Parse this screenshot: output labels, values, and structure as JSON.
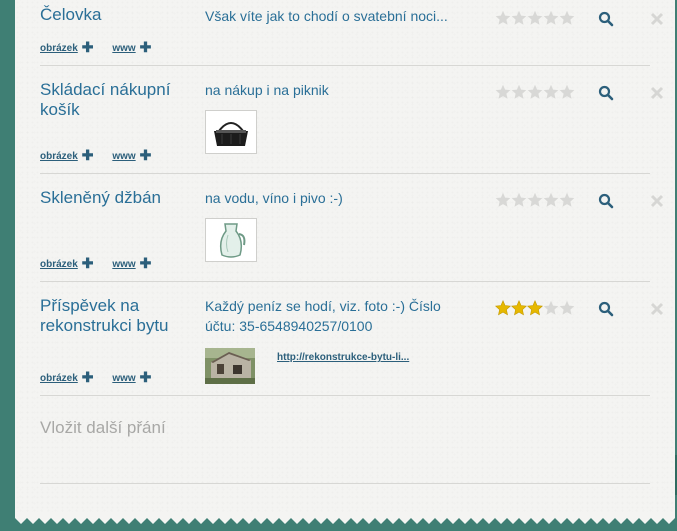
{
  "items": [
    {
      "title": "Čelovka",
      "description": "Však víte jak to chodí o svatební noci...",
      "image_link": "obrázek",
      "www_link": "www",
      "rating": 0,
      "rating_max": 5
    },
    {
      "title": "Skládací nákupní košík",
      "description": "na nákup i na piknik",
      "image_link": "obrázek",
      "www_link": "www",
      "rating": 0,
      "rating_max": 5
    },
    {
      "title": "Skleněný džbán",
      "description": "na vodu, víno i pivo :-)",
      "image_link": "obrázek",
      "www_link": "www",
      "rating": 0,
      "rating_max": 5
    },
    {
      "title": "Příspěvek na rekonstrukci bytu",
      "description": "Každý peníz se hodí, viz. foto :-) Číslo účtu: 35-6548940257/0100",
      "image_link": "obrázek",
      "www_link": "www",
      "url": "http://rekonstrukce-bytu-li...",
      "rating": 3,
      "rating_max": 5
    }
  ],
  "new_wish_placeholder": "Vložit další přání",
  "colors": {
    "background": "#3f7f74",
    "paper": "#f4f4f2",
    "title": "#2a6f97",
    "star_filled": "#e6b800",
    "star_empty": "#d8d8d6",
    "icon": "#2c5f7b"
  }
}
